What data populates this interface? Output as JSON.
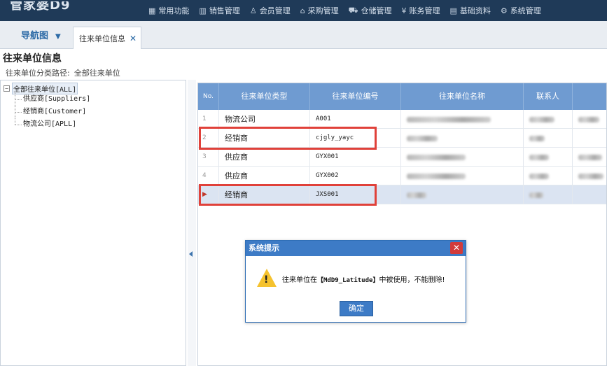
{
  "brand": "管家婆D9",
  "top_menu": [
    {
      "icon": "grid-icon",
      "glyph": "▦",
      "label": "常用功能"
    },
    {
      "icon": "chart-icon",
      "glyph": "▥",
      "label": "销售管理"
    },
    {
      "icon": "user-icon",
      "glyph": "♙",
      "label": "会员管理"
    },
    {
      "icon": "home-icon",
      "glyph": "⌂",
      "label": "采购管理"
    },
    {
      "icon": "cart-icon",
      "glyph": "⛟",
      "label": "仓储管理"
    },
    {
      "icon": "yen-icon",
      "glyph": "¥",
      "label": "账务管理"
    },
    {
      "icon": "doc-icon",
      "glyph": "▤",
      "label": "基础资料"
    },
    {
      "icon": "gear-icon",
      "glyph": "⚙",
      "label": "系统管理"
    }
  ],
  "tabs": {
    "nav_label": "导航图",
    "page_tab_label": "往来单位信息"
  },
  "page": {
    "title": "往来单位信息",
    "breadcrumb_label": "往来单位分类路径:",
    "breadcrumb_value": "全部往来单位"
  },
  "tree": {
    "root": "全部往来单位[ALL]",
    "children": [
      "供应商[Suppliers]",
      "经销商[Customer]",
      "物流公司[APLL]"
    ]
  },
  "grid": {
    "columns": [
      "No.",
      "往来单位类型",
      "往来单位编号",
      "往来单位名称",
      "联系人"
    ],
    "rows": [
      {
        "no": "1",
        "type": "物流公司",
        "code": "A001"
      },
      {
        "no": "2",
        "type": "经销商",
        "code": "cjgly_yayc"
      },
      {
        "no": "3",
        "type": "供应商",
        "code": "GYX001"
      },
      {
        "no": "4",
        "type": "供应商",
        "code": "GYX002"
      },
      {
        "no": "▶",
        "type": "经销商",
        "code": "JXS001"
      }
    ],
    "selected_row": 5
  },
  "dialog": {
    "title": "系统提示",
    "message_prefix": "往来单位在",
    "message_code": "【MdD9_Latitude】",
    "message_suffix": "中被使用，不能删除!",
    "ok_label": "确定"
  },
  "colors": {
    "topbar": "#1f3a58",
    "grid_header": "#6f9bd1",
    "highlight": "#e0413a",
    "dialog_title": "#3d7bc6"
  }
}
